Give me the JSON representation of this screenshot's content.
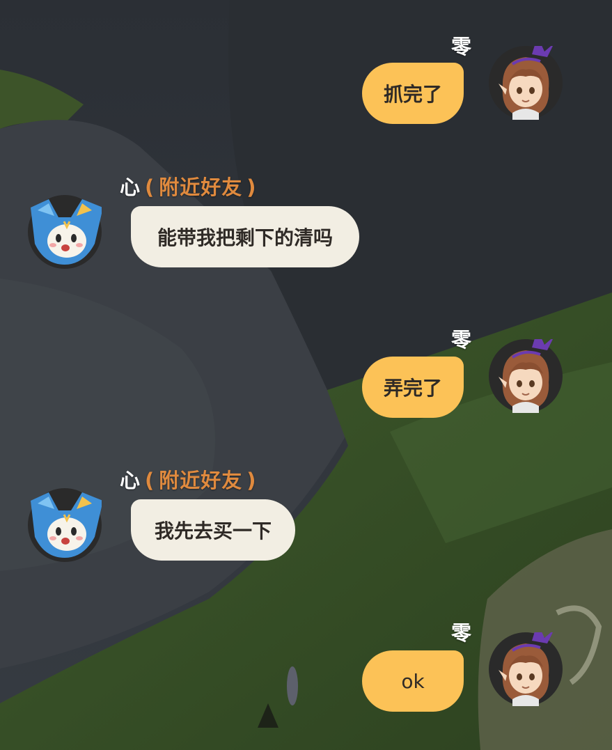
{
  "colors": {
    "mine_bubble": "#fcc257",
    "theirs_bubble": "#f2eee3",
    "tag": "#e08a3e",
    "name": "#ffffff"
  },
  "messages": [
    {
      "sender": "零",
      "side": "right",
      "avatar": "girl-avatar-icon",
      "text": "抓完了"
    },
    {
      "sender": "心",
      "tag": "附近好友",
      "side": "left",
      "avatar": "blue-cat-avatar-icon",
      "text": "能带我把剩下的清吗"
    },
    {
      "sender": "零",
      "side": "right",
      "avatar": "girl-avatar-icon",
      "text": "弄完了"
    },
    {
      "sender": "心",
      "tag": "附近好友",
      "side": "left",
      "avatar": "blue-cat-avatar-icon",
      "text": "我先去买一下"
    },
    {
      "sender": "零",
      "side": "right",
      "avatar": "girl-avatar-icon",
      "text": "ok"
    }
  ],
  "paren_open": "(",
  "paren_close": ")"
}
